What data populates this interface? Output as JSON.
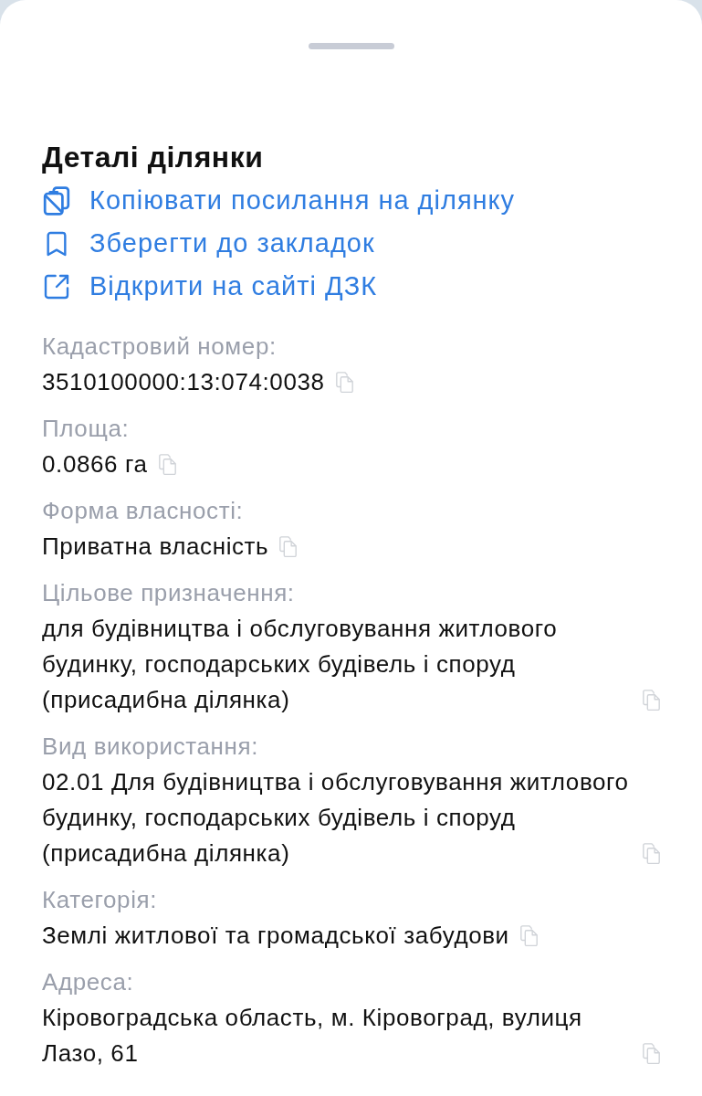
{
  "sheet": {
    "title": "Деталі ділянки"
  },
  "actions": [
    {
      "kind": "copy",
      "label": "Копіювати посилання на ділянку"
    },
    {
      "kind": "bookmark",
      "label": "Зберегти до закладок"
    },
    {
      "kind": "external",
      "label": "Відкрити на сайті ДЗК"
    }
  ],
  "fields": [
    {
      "label": "Кадастровий номер:",
      "value": "3510100000:13:074:0038"
    },
    {
      "label": "Площа:",
      "value": "0.0866 га"
    },
    {
      "label": "Форма власності:",
      "value": "Приватна власність"
    },
    {
      "label": "Цільове призначення:",
      "value": "для будівництва і обслуговування житлового будинку, господарських будівель і споруд (присадибна ділянка)"
    },
    {
      "label": "Вид використання:",
      "value": "02.01 Для будівництва і обслуговування житлового будинку, господарських будівель і споруд (присадибна ділянка)"
    },
    {
      "label": "Категорія:",
      "value": "Землі житлової та громадської забудови"
    },
    {
      "label": "Адреса:",
      "value": "Кіровоградська область, м. Кіровоград, вулиця Лазо, 61"
    }
  ]
}
